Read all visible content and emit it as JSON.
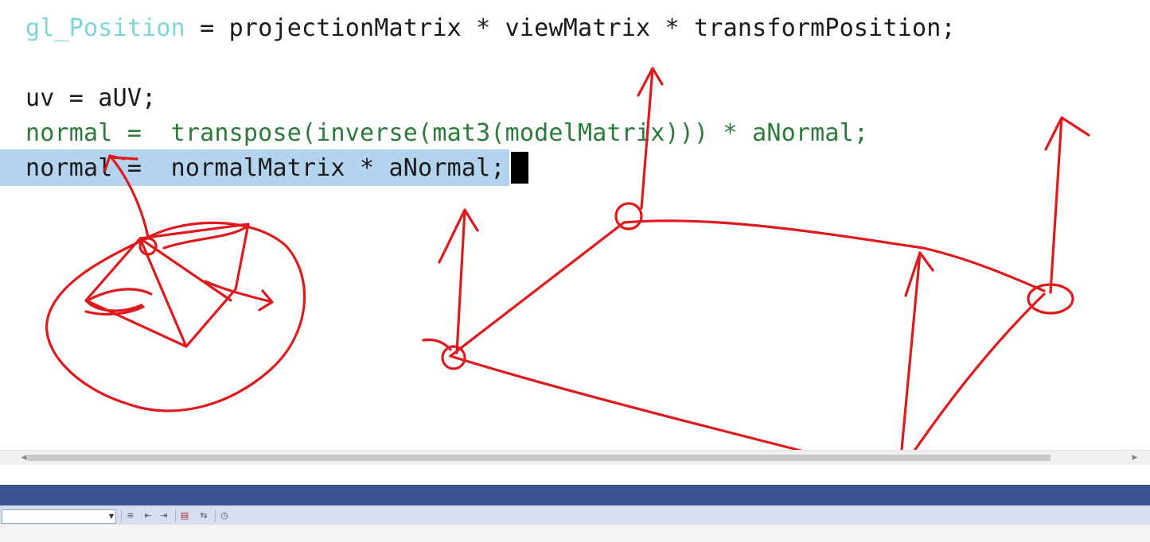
{
  "editor": {
    "lines": [
      {
        "builtin": "gl_Position",
        "rest": " = projectionMatrix * viewMatrix * transformPosition;"
      },
      {
        "text": "uv = aUV;"
      },
      {
        "text": "normal =  transpose(inverse(mat3(modelMatrix))) * aNormal;"
      },
      {
        "text": "normal =  normalMatrix * aNormal;"
      }
    ]
  },
  "colors": {
    "builtin": "#7fd6da",
    "comment": "#2b7a3a",
    "selection": "#b4d3ef",
    "annotation": "#e0191c",
    "panel_bar": "#3c5591",
    "toolbar": "#d5dff0"
  },
  "toolbar": {
    "icons": [
      "combo-dropdown-icon",
      "indent-icon",
      "outdent-left-icon",
      "outdent-right-icon",
      "breakpoint-icon",
      "word-wrap-icon",
      "clock-icon"
    ]
  }
}
